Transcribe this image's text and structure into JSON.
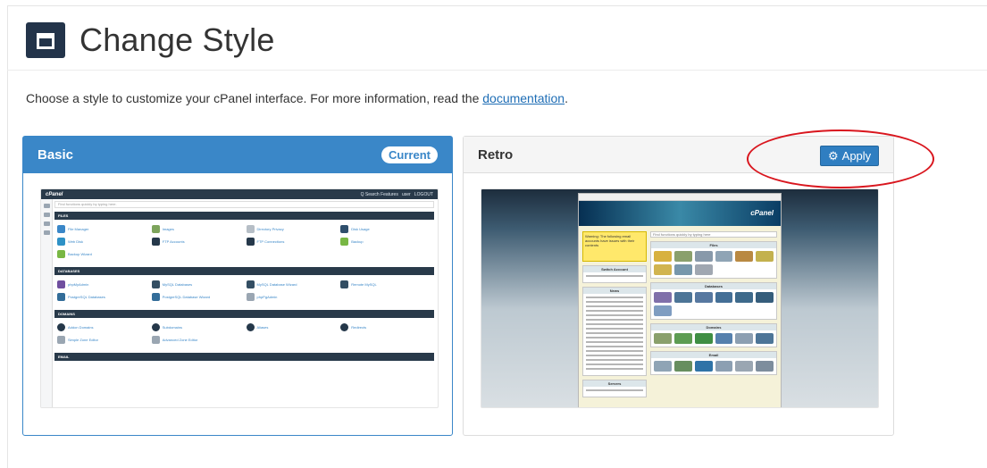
{
  "page": {
    "title": "Change Style",
    "intro_text": "Choose a style to customize your cPanel interface. For more information, read the ",
    "intro_link": "documentation",
    "intro_end": "."
  },
  "styles": [
    {
      "name": "Basic",
      "badge": "Current",
      "preview": "Basic cPanel style preview"
    },
    {
      "name": "Retro",
      "action": "Apply",
      "preview": "Retro cPanel style preview"
    }
  ],
  "colors": {
    "primary": "#3a87c8",
    "header_dark": "#23344a",
    "annotation": "#d9161e"
  }
}
